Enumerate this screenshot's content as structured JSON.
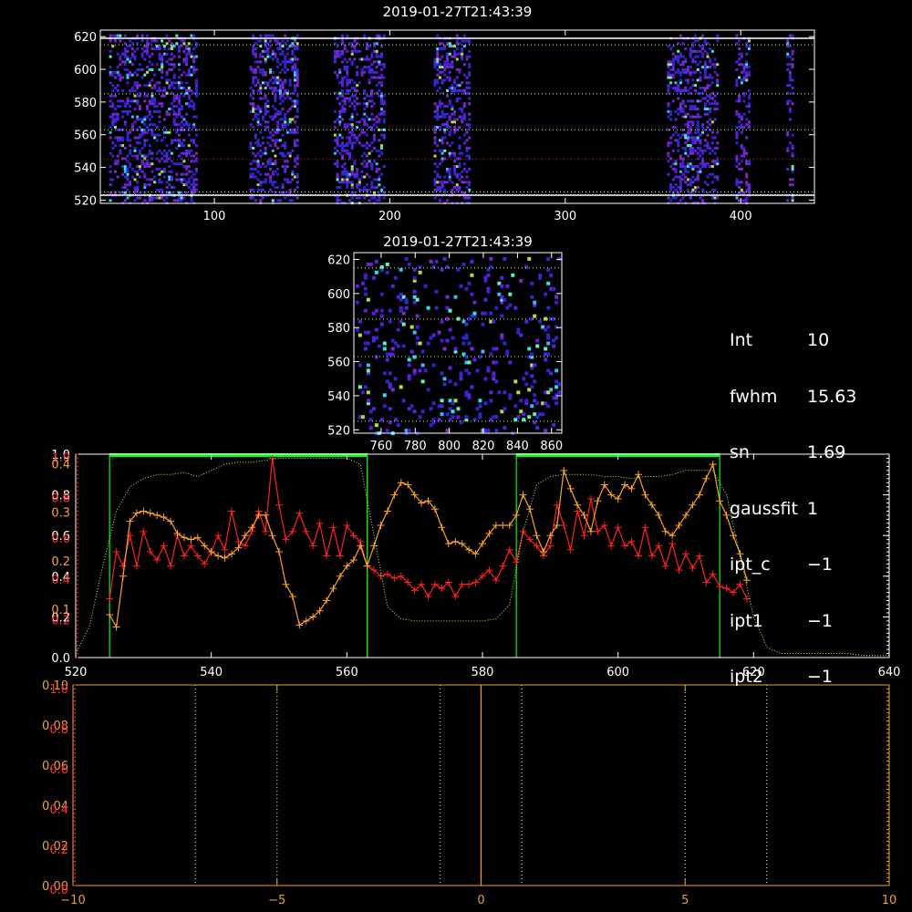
{
  "info": {
    "rows": [
      {
        "key": "Int",
        "value": "10"
      },
      {
        "key": "fwhm",
        "value": "15.63"
      },
      {
        "key": "sn",
        "value": "1.69"
      },
      {
        "key": "gaussfit",
        "value": "1"
      },
      {
        "key": "ipt_c",
        "value": "−1"
      },
      {
        "key": "ipt1",
        "value": "−1"
      },
      {
        "key": "ipt2",
        "value": "−1"
      }
    ]
  },
  "colors": {
    "axis": "#ffffff",
    "axis_lower": "#e8a23a",
    "green": "#00ff00",
    "red": "#ff2020",
    "orange": "#ffa028",
    "red_label": "#ff3030",
    "yellow_dotted": "#ffff80",
    "green_dotted": "#a8ff60",
    "red_dotted": "#c03030"
  },
  "chart_data": [
    {
      "type": "heatmap",
      "title": "2019-01-27T21:43:39",
      "xlim": [
        35,
        442
      ],
      "ylim": [
        518,
        624
      ],
      "xticks": [
        100,
        200,
        300,
        400
      ],
      "yticks": [
        520,
        540,
        560,
        580,
        600,
        620
      ],
      "column_bands": [
        [
          40,
          90
        ],
        [
          120,
          147
        ],
        [
          168,
          197
        ],
        [
          225,
          246
        ],
        [
          358,
          386
        ],
        [
          397,
          405
        ],
        [
          426,
          429
        ]
      ],
      "horizontal_white_lines": [
        523,
        619
      ],
      "horizontal_green_dotted": [
        525,
        563,
        585,
        615
      ],
      "horizontal_red_dotted": [
        545
      ]
    },
    {
      "type": "heatmap",
      "title": "2019-01-27T21:43:39",
      "xlim": [
        744,
        866
      ],
      "ylim": [
        518,
        624
      ],
      "xticks": [
        760,
        780,
        800,
        820,
        840,
        860
      ],
      "yticks": [
        520,
        540,
        560,
        580,
        600,
        620
      ],
      "horizontal_green_dotted": [
        525,
        563,
        585,
        615
      ]
    },
    {
      "type": "line",
      "xlim": [
        520,
        640
      ],
      "xticks": [
        520,
        540,
        560,
        580,
        600,
        620,
        640
      ],
      "ylim_left": [
        0,
        1
      ],
      "left_ticks_white": [
        "0.0",
        "0.2",
        "0.4",
        "0.6",
        "0.8",
        "1.0"
      ],
      "left_ticks_red": [
        "0.2",
        "0.4",
        "0.6",
        "0.8",
        "1.0"
      ],
      "left_ticks_orange": [
        "0.1",
        "0.2",
        "0.3",
        "0.4"
      ],
      "green_regions": [
        [
          525,
          563
        ],
        [
          585,
          615
        ]
      ],
      "series": [
        {
          "color": "red",
          "x": [
            525,
            526,
            527,
            528,
            529,
            530,
            531,
            532,
            533,
            534,
            535,
            536,
            537,
            538,
            539,
            540,
            541,
            542,
            543,
            544,
            545,
            546,
            547,
            548,
            549,
            550,
            551,
            552,
            553,
            554,
            555,
            556,
            557,
            558,
            559,
            560,
            561,
            562,
            563,
            564,
            565,
            566,
            567,
            568,
            569,
            570,
            571,
            572,
            573,
            574,
            575,
            576,
            577,
            578,
            579,
            580,
            581,
            582,
            583,
            584,
            585,
            586,
            587,
            588,
            589,
            590,
            591,
            592,
            593,
            594,
            595,
            596,
            597,
            598,
            599,
            600,
            601,
            602,
            603,
            604,
            605,
            606,
            607,
            608,
            609,
            610,
            611,
            612,
            613,
            614,
            615,
            616,
            617,
            618,
            619
          ],
          "y": [
            0.29,
            0.52,
            0.45,
            0.6,
            0.45,
            0.62,
            0.52,
            0.48,
            0.55,
            0.45,
            0.6,
            0.5,
            0.55,
            0.5,
            0.46,
            0.52,
            0.6,
            0.53,
            0.72,
            0.57,
            0.55,
            0.62,
            0.72,
            0.62,
            0.98,
            0.75,
            0.58,
            0.62,
            0.71,
            0.62,
            0.55,
            0.66,
            0.5,
            0.64,
            0.5,
            0.65,
            0.6,
            0.57,
            0.45,
            0.43,
            0.4,
            0.41,
            0.39,
            0.4,
            0.37,
            0.33,
            0.36,
            0.3,
            0.36,
            0.34,
            0.37,
            0.3,
            0.36,
            0.36,
            0.37,
            0.4,
            0.43,
            0.38,
            0.45,
            0.53,
            0.47,
            0.62,
            0.58,
            0.55,
            0.5,
            0.55,
            0.75,
            0.65,
            0.53,
            0.72,
            0.6,
            0.78,
            0.62,
            0.65,
            0.55,
            0.64,
            0.55,
            0.57,
            0.5,
            0.64,
            0.5,
            0.55,
            0.45,
            0.56,
            0.43,
            0.51,
            0.44,
            0.5,
            0.37,
            0.41,
            0.35,
            0.34,
            0.32,
            0.36,
            0.29
          ]
        },
        {
          "color": "orange",
          "x": [
            525,
            526,
            527,
            528,
            529,
            530,
            531,
            532,
            533,
            534,
            535,
            536,
            537,
            538,
            539,
            540,
            541,
            542,
            543,
            544,
            545,
            546,
            547,
            548,
            549,
            550,
            551,
            552,
            553,
            554,
            555,
            556,
            557,
            558,
            559,
            560,
            561,
            562,
            563,
            564,
            565,
            566,
            567,
            568,
            569,
            570,
            571,
            572,
            573,
            574,
            575,
            576,
            577,
            578,
            579,
            580,
            581,
            582,
            583,
            584,
            585,
            586,
            587,
            588,
            589,
            590,
            591,
            592,
            593,
            594,
            595,
            596,
            597,
            598,
            599,
            600,
            601,
            602,
            603,
            604,
            605,
            606,
            607,
            608,
            609,
            610,
            611,
            612,
            613,
            614,
            615,
            616,
            617,
            618,
            619
          ],
          "y": [
            0.21,
            0.15,
            0.4,
            0.67,
            0.71,
            0.72,
            0.71,
            0.7,
            0.69,
            0.67,
            0.61,
            0.59,
            0.58,
            0.59,
            0.55,
            0.52,
            0.5,
            0.49,
            0.51,
            0.54,
            0.6,
            0.64,
            0.7,
            0.7,
            0.6,
            0.52,
            0.36,
            0.3,
            0.16,
            0.18,
            0.2,
            0.23,
            0.28,
            0.34,
            0.4,
            0.45,
            0.48,
            0.55,
            0.45,
            0.55,
            0.65,
            0.72,
            0.8,
            0.86,
            0.85,
            0.8,
            0.76,
            0.77,
            0.73,
            0.64,
            0.56,
            0.57,
            0.56,
            0.53,
            0.51,
            0.56,
            0.61,
            0.65,
            0.65,
            0.65,
            0.7,
            0.8,
            0.73,
            0.6,
            0.52,
            0.6,
            0.65,
            0.92,
            0.83,
            0.75,
            0.7,
            0.62,
            0.77,
            0.85,
            0.8,
            0.78,
            0.85,
            0.83,
            0.9,
            0.8,
            0.75,
            0.7,
            0.62,
            0.6,
            0.65,
            0.7,
            0.75,
            0.8,
            0.88,
            0.95,
            0.77,
            0.7,
            0.6,
            0.51,
            0.38
          ]
        },
        {
          "color": "green_dotted",
          "x": [
            520,
            522,
            524,
            526,
            528,
            530,
            532,
            534,
            536,
            538,
            540,
            542,
            544,
            546,
            548,
            550,
            552,
            554,
            556,
            558,
            560,
            562,
            564,
            566,
            568,
            570,
            572,
            574,
            576,
            578,
            580,
            582,
            584,
            586,
            588,
            590,
            592,
            594,
            596,
            598,
            600,
            602,
            604,
            606,
            608,
            610,
            612,
            614,
            616,
            618,
            620,
            622,
            624,
            626,
            628,
            630,
            632,
            634,
            636,
            638,
            640
          ],
          "y": [
            0.02,
            0.15,
            0.45,
            0.72,
            0.84,
            0.88,
            0.9,
            0.9,
            0.91,
            0.89,
            0.92,
            0.95,
            0.96,
            0.96,
            0.97,
            0.98,
            0.98,
            0.98,
            0.98,
            0.98,
            0.98,
            0.95,
            0.6,
            0.25,
            0.19,
            0.18,
            0.18,
            0.18,
            0.18,
            0.18,
            0.18,
            0.19,
            0.26,
            0.62,
            0.85,
            0.89,
            0.9,
            0.9,
            0.9,
            0.89,
            0.89,
            0.88,
            0.89,
            0.89,
            0.9,
            0.92,
            0.92,
            0.92,
            0.8,
            0.5,
            0.2,
            0.05,
            0.02,
            0.02,
            0.02,
            0.02,
            0.02,
            0.02,
            0.01,
            0.01,
            0.01
          ]
        }
      ]
    },
    {
      "type": "line",
      "xlim": [
        -10,
        10
      ],
      "xticks": [
        -10,
        -5,
        0,
        5,
        10
      ],
      "left_ticks_white": [
        "0.00",
        "0.02",
        "0.04",
        "0.06",
        "0.08",
        "0.10"
      ],
      "left_ticks_red": [
        "0.0",
        "0.2",
        "0.4",
        "0.6",
        "0.8",
        "1.0"
      ],
      "vertical_dotted": [
        -7,
        -5,
        -1,
        1,
        5,
        7
      ],
      "vertical_solid": [
        0
      ]
    }
  ]
}
